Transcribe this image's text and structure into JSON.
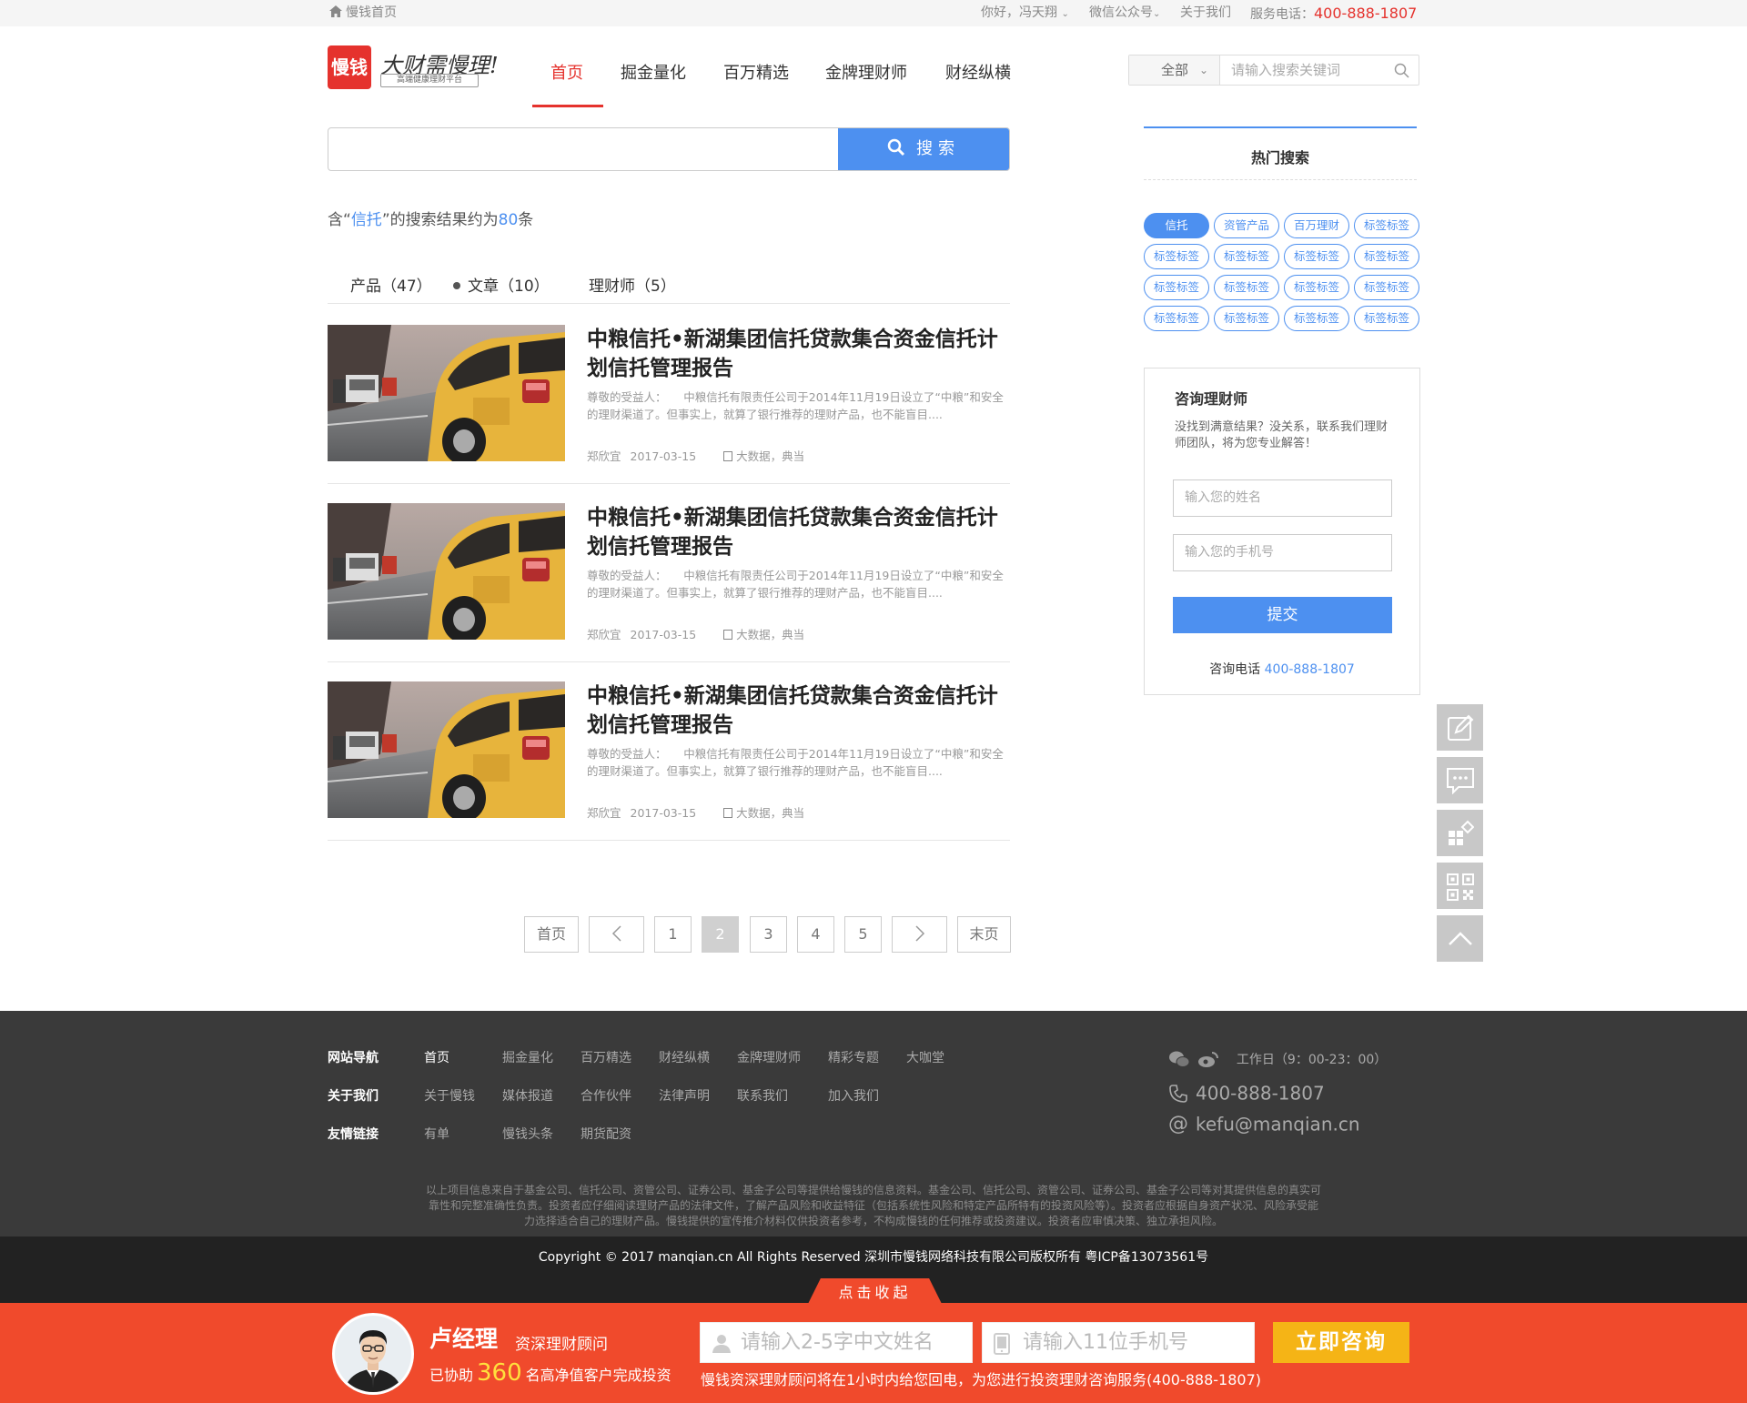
{
  "topbar": {
    "home_link": "慢钱首页",
    "greeting": "你好，冯天翔",
    "wechat": "微信公众号",
    "about": "关于我们",
    "service_label": "服务电话：",
    "service_phone": "400-888-1807"
  },
  "header": {
    "logo_text": "慢钱",
    "slogan": "大财需慢理!",
    "subslogan": "高端健康理财平台",
    "nav": [
      "首页",
      "掘金量化",
      "百万精选",
      "金牌理财师",
      "财经纵横"
    ],
    "active_nav": "首页",
    "search_scope": "全部",
    "search_placeholder": "请输入搜索关键词"
  },
  "main_search": {
    "value": "",
    "button": "搜索"
  },
  "result": {
    "prefix": "含“",
    "keyword": "信托",
    "middle": "”的搜索结果约为",
    "count": "80",
    "suffix": "条"
  },
  "tabs": [
    "产品（47）",
    "文章（10）",
    "理财师（5）"
  ],
  "active_tab": "文章（10）",
  "articles": [
    {
      "title": "中粮信托•新湖集团信托贷款集合资金信托计划信托管理报告",
      "desc": "尊敬的受益人：　　中粮信托有限责任公司于2014年11月19日设立了“中粮”和安全的理财渠道了。但事实上，就算了银行推荐的理财产品，也不能盲目....",
      "author": "郑欣宜",
      "date": "2017-03-15",
      "tags": "大数据，典当"
    },
    {
      "title": "中粮信托•新湖集团信托贷款集合资金信托计划信托管理报告",
      "desc": "尊敬的受益人：　　中粮信托有限责任公司于2014年11月19日设立了“中粮”和安全的理财渠道了。但事实上，就算了银行推荐的理财产品，也不能盲目....",
      "author": "郑欣宜",
      "date": "2017-03-15",
      "tags": "大数据，典当"
    },
    {
      "title": "中粮信托•新湖集团信托贷款集合资金信托计划信托管理报告",
      "desc": "尊敬的受益人：　　中粮信托有限责任公司于2014年11月19日设立了“中粮”和安全的理财渠道了。但事实上，就算了银行推荐的理财产品，也不能盲目....",
      "author": "郑欣宜",
      "date": "2017-03-15",
      "tags": "大数据，典当"
    }
  ],
  "pagination": {
    "first": "首页",
    "pages": [
      "1",
      "2",
      "3",
      "4",
      "5"
    ],
    "current": "2",
    "last": "末页"
  },
  "hot_search": {
    "title": "热门搜索",
    "tags": [
      "信托",
      "资管产品",
      "百万理财",
      "标签标签",
      "标签标签",
      "标签标签",
      "标签标签",
      "标签标签",
      "标签标签",
      "标签标签",
      "标签标签",
      "标签标签",
      "标签标签",
      "标签标签",
      "标签标签",
      "标签标签"
    ],
    "active": "信托"
  },
  "consult": {
    "title": "咨询理财师",
    "desc": "没找到满意结果？没关系，联系我们理财师团队，将为您专业解答！",
    "name_placeholder": "输入您的姓名",
    "phone_placeholder": "输入您的手机号",
    "submit": "提交",
    "phone_label": "咨询电话",
    "phone": "400-888-1807"
  },
  "float_tools": [
    "edit-icon",
    "chat-icon",
    "apps-icon",
    "qrcode-icon",
    "back-to-top-icon"
  ],
  "footer": {
    "rows": [
      {
        "label": "网站导航",
        "links": [
          "首页",
          "掘金量化",
          "百万精选",
          "财经纵横",
          "金牌理财师",
          "精彩专题",
          "大咖堂"
        ]
      },
      {
        "label": "关于我们",
        "links": [
          "关于慢钱",
          "媒体报道",
          "合作伙伴",
          "法律声明",
          "联系我们",
          "加入我们"
        ]
      },
      {
        "label": "友情链接",
        "links": [
          "有单",
          "慢钱头条",
          "期货配资"
        ]
      }
    ],
    "hours": "工作日（9：00-23：00）",
    "phone": "400-888-1807",
    "email": "kefu@manqian.cn",
    "note": "以上项目信息来自于基金公司、信托公司、资管公司、证券公司、基金子公司等提供给慢钱的信息资料。基金公司、信托公司、资管公司、证券公司、基金子公司等对其提供信息的真实可靠性和完整准确性负责。投资者应仔细阅读理财产品的法律文件，了解产品风险和收益特征（包括系统性风险和特定产品所特有的投资风险等）。投资者应根据自身资产状况、风险承受能力选择适合自己的理财产品。慢钱提供的宣传推介材料仅供投资者参考，不构成慢钱的任何推荐或投资建议。投资者应审慎决策、独立承担风险。",
    "copyright": "Copyright © 2017 manqian.cn All Rights Reserved 深圳市慢钱网络科技有限公司版权所有 粤ICP备13073561号"
  },
  "bottom_bar": {
    "collapse": "点击收起",
    "manager_name": "卢经理",
    "manager_title": "资深理财顾问",
    "helped_prefix": "已协助",
    "helped_count": "360",
    "helped_suffix": "名高净值客户完成投资",
    "name_placeholder": "请输入2-5字中文姓名",
    "phone_placeholder": "请输入11位手机号",
    "button": "立即咨询",
    "note": "慢钱资深理财顾问将在1小时内给您回电，为您进行投资理财咨询服务(400-888-1807)"
  },
  "colors": {
    "brand_red": "#e5322d",
    "accent_blue": "#4d90f0",
    "bar_orange": "#f04a2c",
    "button_yellow": "#f5b416"
  }
}
